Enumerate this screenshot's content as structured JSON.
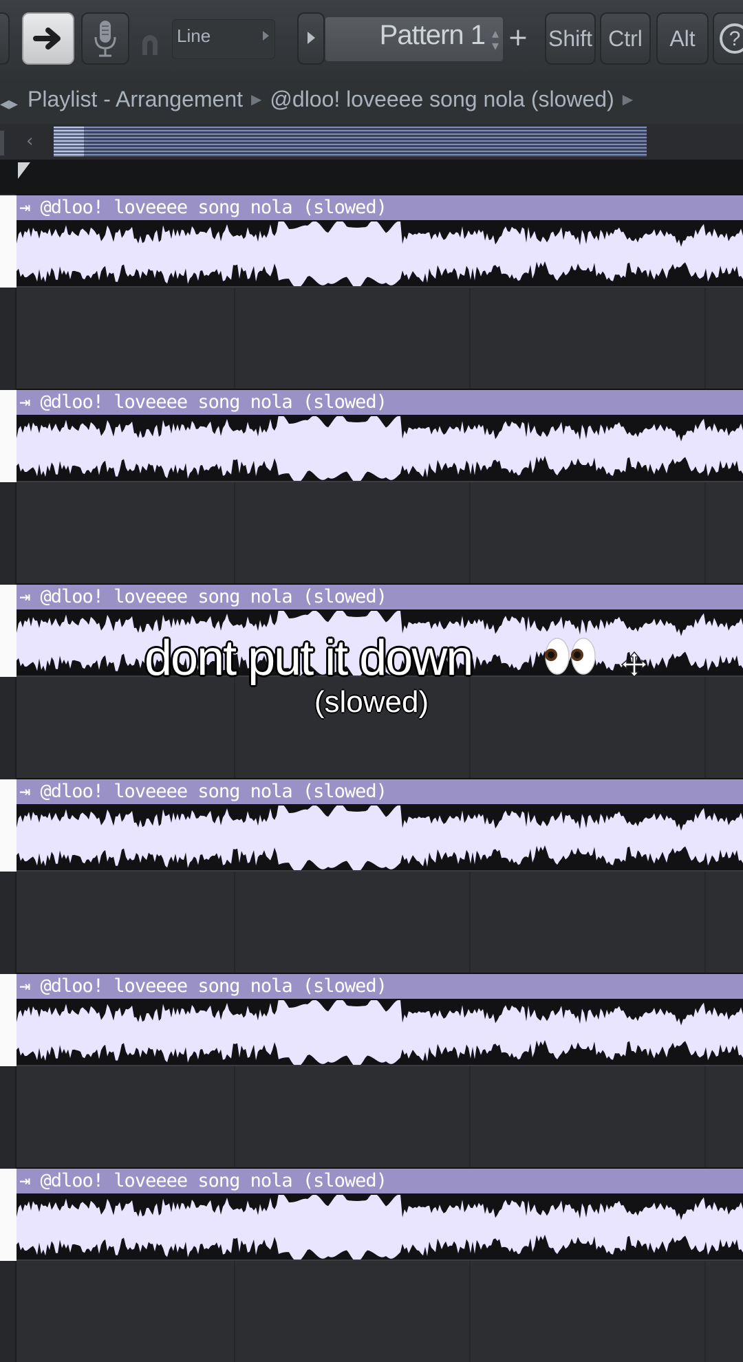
{
  "toolbar": {
    "snap_mode": "Line",
    "pattern_name": "Pattern 1",
    "pattern_add": "+",
    "keys": {
      "shift": "Shift",
      "ctrl": "Ctrl",
      "alt": "Alt"
    },
    "help": "?"
  },
  "breadcrumb": {
    "window": "Playlist - Arrangement",
    "clip": "@dloo! loveeee song nola (slowed)"
  },
  "tracks": [
    {
      "clip_title": "@dloo! loveeee song nola (slowed)"
    },
    {
      "clip_title": "@dloo! loveeee song nola (slowed)"
    },
    {
      "clip_title": "@dloo! loveeee song nola (slowed)"
    },
    {
      "clip_title": "@dloo! loveeee song nola (slowed)"
    },
    {
      "clip_title": "@dloo! loveeee song nola (slowed)"
    },
    {
      "clip_title": "@dloo! loveeee song nola (slowed)"
    }
  ],
  "overlay": {
    "caption": "dont put it down",
    "subcaption": "(slowed)"
  },
  "colors": {
    "clip_header": "#9a92c6",
    "waveform": "#e9e4ff",
    "clip_body": "#121214",
    "scroll_thumb": "#7d8dbd"
  },
  "icons": [
    "arrow-right-icon",
    "microphone-icon",
    "magnet-icon",
    "help-icon",
    "move-cursor-icon",
    "eyes-emoji-icon"
  ]
}
